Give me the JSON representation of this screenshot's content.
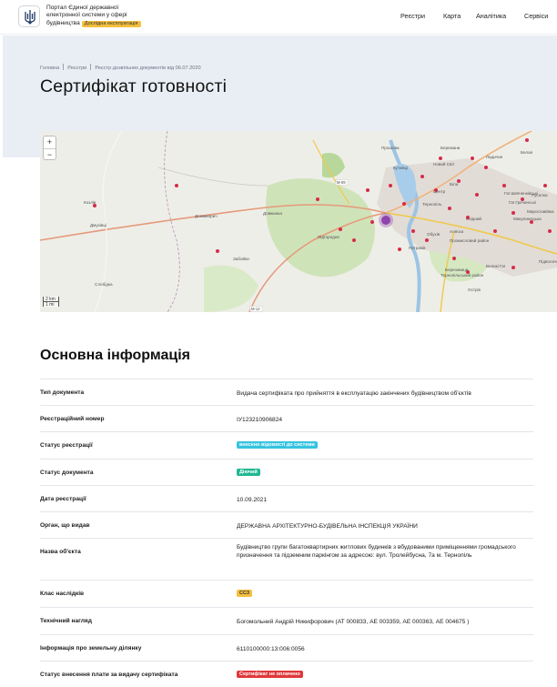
{
  "header": {
    "portal_line1": "Портал Єдиної державної",
    "portal_line2": "електронної системи у сфері",
    "portal_line3": "будівництва",
    "beta_badge": "Дослідна експлуатація",
    "nav": [
      "Реєстри",
      "Карта",
      "Аналітика",
      "Сервіси"
    ]
  },
  "breadcrumbs": [
    "Головна",
    "Реєстри",
    "Реєстр дозвільних документів від 06.07.2020"
  ],
  "page_title": "Сертифікат готовності",
  "map": {
    "zoom_in": "+",
    "zoom_out": "−",
    "scale": [
      "2 km",
      "1 mi"
    ],
    "labels": [
      "Козлів",
      "Дмухівці",
      "Слобідка",
      "Довжанка",
      "Домаморич",
      "Забойки",
      "Підгородне",
      "Петриків",
      "Прошова",
      "Тернопіль",
      "Новий Світ",
      "Кутківці",
      "Центр",
      "Аляска",
      "Березовиця",
      "Великі Гаї",
      "Гаї Гречинські",
      "Бережани",
      "Белая",
      "Східний",
      "Микулинецька",
      "Промисловий район",
      "Русалка",
      "Острів",
      "Біла",
      "Підволочиське",
      "Ладичин",
      "Тернопільський район",
      "Обухів",
      "Гаї Шевченківські",
      "Мирославівка"
    ],
    "road_labels": [
      "М-09",
      "М-12"
    ],
    "accent": "#8e44ad"
  },
  "info": {
    "title": "Основна інформація",
    "rows": [
      {
        "label": "Тип документа",
        "value": "Видача сертифіката про прийняття в експлуатацію закінчених будівництвом об'єктів"
      },
      {
        "label": "Реєстраційний номер",
        "value": "ІУ123210906824"
      },
      {
        "label": "Статус реєстрації",
        "value": "внесено відомості до системи",
        "tag": true,
        "tag_bg": "#36c3e0",
        "tag_fg": "#ffffff"
      },
      {
        "label": "Статус документа",
        "value": "Діючий",
        "tag": true,
        "tag_bg": "#1fb890",
        "tag_fg": "#ffffff"
      },
      {
        "label": "Дата реєстрації",
        "value": "10.09.2021"
      },
      {
        "label": "Орган, що видав",
        "value": "ДЕРЖАВНА АРХІТЕКТУРНО-БУДІВЕЛЬНА ІНСПЕКЦІЯ УКРАЇНИ"
      },
      {
        "label": "Назва об'єкта",
        "value": "Будівництво групи багатоквартирних житлових будинків з вбудованими приміщеннями громадського призначення та підземним паркінгом за адресою: вул. Тролейбусна, 7а м. Тернопіль"
      },
      {
        "label": "Клас наслідків",
        "value": "СС3",
        "tag": true,
        "tag_bg": "#f4bf3d",
        "tag_fg": "#333333"
      },
      {
        "label": "Технічний нагляд",
        "value": "Богомольний Андрій Никифорович (АТ 000833, АЕ 003359, АЕ 000363, АЕ 004675 )"
      },
      {
        "label": "Інформація про земельну ділянку",
        "value": "6110100000:13:006:0056"
      },
      {
        "label": "Статус внесення плати за видачу сертифіката",
        "value": "Сертифікат не оплачено",
        "tag": true,
        "tag_bg": "#e0383a",
        "tag_fg": "#ffffff"
      }
    ]
  }
}
